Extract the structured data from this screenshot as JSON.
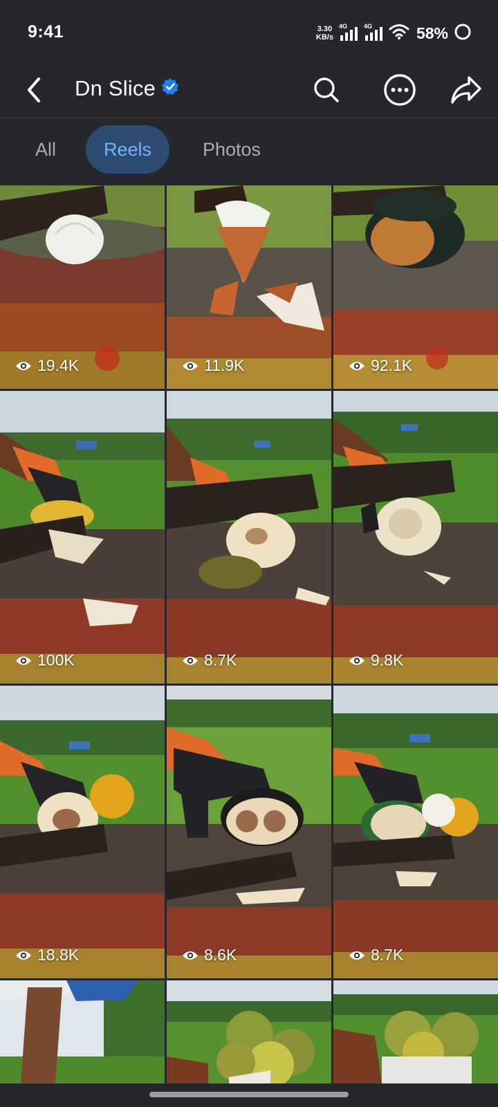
{
  "status_bar": {
    "time": "9:41",
    "net_speed_value": "3.30",
    "net_speed_unit": "KB/s",
    "sim1_tag": "4G",
    "sim2_tag": "4G",
    "battery": "58%"
  },
  "header": {
    "title": "Dn Slice",
    "verified": true,
    "icons": [
      "back-arrow-icon",
      "search-icon",
      "more-options-icon",
      "share-icon"
    ]
  },
  "tabs": [
    {
      "label": "All",
      "active": false
    },
    {
      "label": "Reels",
      "active": true
    },
    {
      "label": "Photos",
      "active": false
    }
  ],
  "reels": [
    {
      "views": "19.4K",
      "scene": "white palm fruit on red stump"
    },
    {
      "views": "11.9K",
      "scene": "husked palm fruit on stump"
    },
    {
      "views": "92.1K",
      "scene": "dark palm fruit on stump"
    },
    {
      "views": "100K",
      "scene": "yellow palm fruit sliced in field"
    },
    {
      "views": "8.7K",
      "scene": "machete slicing palm fruit"
    },
    {
      "views": "9.8K",
      "scene": "palm fruit under machete"
    },
    {
      "views": "18.8K",
      "scene": "slicing with orange fruit behind"
    },
    {
      "views": "8.6K",
      "scene": "gloved hand holding sliced fruit"
    },
    {
      "views": "8.7K",
      "scene": "green fruit sliced on stump"
    },
    {
      "views": "",
      "scene": "machete close-up"
    },
    {
      "views": "",
      "scene": "pile of palm fruits"
    },
    {
      "views": "",
      "scene": "palm fruits with blade"
    }
  ],
  "colors": {
    "background": "#25272c",
    "active_tab_bg": "#2d4a71",
    "active_tab_text": "#74b2ff",
    "inactive_tab_text": "#a9adb5",
    "verified_badge": "#1d7ff0"
  }
}
